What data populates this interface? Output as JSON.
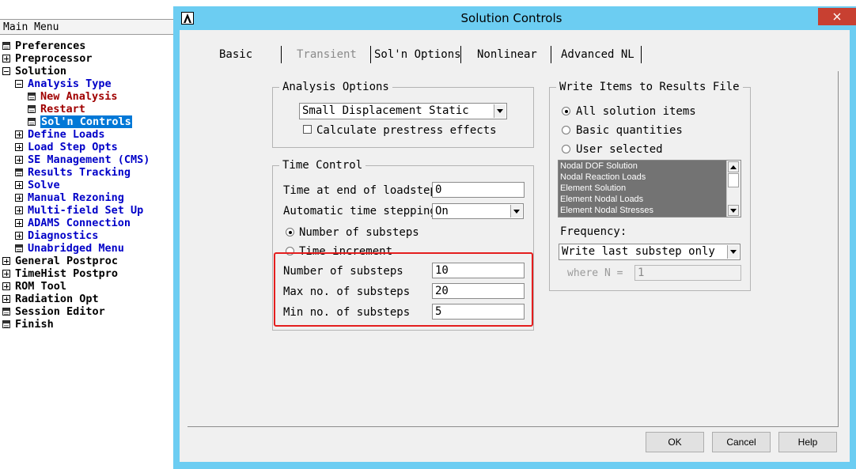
{
  "main_menu": {
    "header": "Main Menu",
    "items": [
      {
        "label": "Preferences",
        "icon": "doc-icon",
        "color": "#000000"
      },
      {
        "label": "Preprocessor",
        "icon": "expand-icon",
        "color": "#000000"
      },
      {
        "label": "Solution",
        "icon": "collapse-icon",
        "color": "#000000"
      },
      {
        "label": "Analysis Type",
        "icon": "collapse-icon",
        "color": "#0000c8"
      },
      {
        "label": "New Analysis",
        "icon": "doc-icon",
        "color": "#a00000"
      },
      {
        "label": "Restart",
        "icon": "doc-icon",
        "color": "#a00000"
      },
      {
        "label": "Sol'n Controls",
        "icon": "doc-icon",
        "color": "#ffffff",
        "selected": true
      },
      {
        "label": "Define Loads",
        "icon": "expand-icon",
        "color": "#0000c8"
      },
      {
        "label": "Load Step Opts",
        "icon": "expand-icon",
        "color": "#0000c8"
      },
      {
        "label": "SE Management (CMS)",
        "icon": "expand-icon",
        "color": "#0000c8"
      },
      {
        "label": "Results Tracking",
        "icon": "doc-icon",
        "color": "#0000c8"
      },
      {
        "label": "Solve",
        "icon": "expand-icon",
        "color": "#0000c8"
      },
      {
        "label": "Manual Rezoning",
        "icon": "expand-icon",
        "color": "#0000c8"
      },
      {
        "label": "Multi-field Set Up",
        "icon": "expand-icon",
        "color": "#0000c8"
      },
      {
        "label": "ADAMS Connection",
        "icon": "expand-icon",
        "color": "#0000c8"
      },
      {
        "label": "Diagnostics",
        "icon": "expand-icon",
        "color": "#0000c8"
      },
      {
        "label": "Unabridged Menu",
        "icon": "doc-icon",
        "color": "#0000c8"
      },
      {
        "label": "General Postproc",
        "icon": "expand-icon",
        "color": "#000000"
      },
      {
        "label": "TimeHist Postpro",
        "icon": "expand-icon",
        "color": "#000000"
      },
      {
        "label": "ROM Tool",
        "icon": "expand-icon",
        "color": "#000000"
      },
      {
        "label": "Radiation Opt",
        "icon": "expand-icon",
        "color": "#000000"
      },
      {
        "label": "Session Editor",
        "icon": "doc-icon",
        "color": "#000000"
      },
      {
        "label": "Finish",
        "icon": "doc-icon",
        "color": "#000000"
      }
    ]
  },
  "dialog": {
    "title": "Solution Controls",
    "title_bar_color": "#6ccdf2",
    "tabs": [
      {
        "label": "Basic",
        "active": true
      },
      {
        "label": "Transient",
        "disabled": true
      },
      {
        "label": "Sol'n Options"
      },
      {
        "label": "Nonlinear"
      },
      {
        "label": "Advanced NL"
      }
    ],
    "analysis_options": {
      "title": "Analysis Options",
      "analysis_select": "Small Displacement Static",
      "prestress_checkbox": "Calculate prestress effects",
      "prestress_checked": false
    },
    "time_control": {
      "title": "Time Control",
      "time_end_label": "Time at end of loadstep",
      "time_end_value": "0",
      "auto_step_label": "Automatic time stepping",
      "auto_step_value": "On",
      "radio_substeps": "Number of substeps",
      "radio_increment": "Time increment",
      "selected_radio": "Number of substeps",
      "num_substeps_label": "Number of substeps",
      "num_substeps_value": "10",
      "max_substeps_label": "Max no. of substeps",
      "max_substeps_value": "20",
      "min_substeps_label": "Min no. of substeps",
      "min_substeps_value": "5",
      "highlight_color": "#e41e1e"
    },
    "write_items": {
      "title": "Write Items to Results File",
      "radio_all": "All solution items",
      "radio_basic": "Basic quantities",
      "radio_user": "User selected",
      "selected_radio": "All solution items",
      "list_items": [
        "Nodal DOF Solution",
        "Nodal Reaction Loads",
        "Element Solution",
        "Element Nodal Loads",
        "Element Nodal Stresses"
      ],
      "frequency_label": "Frequency:",
      "frequency_value": "Write last substep only",
      "where_n_label": "where N =",
      "where_n_value": "1"
    },
    "buttons": {
      "ok": "OK",
      "cancel": "Cancel",
      "help": "Help"
    }
  }
}
